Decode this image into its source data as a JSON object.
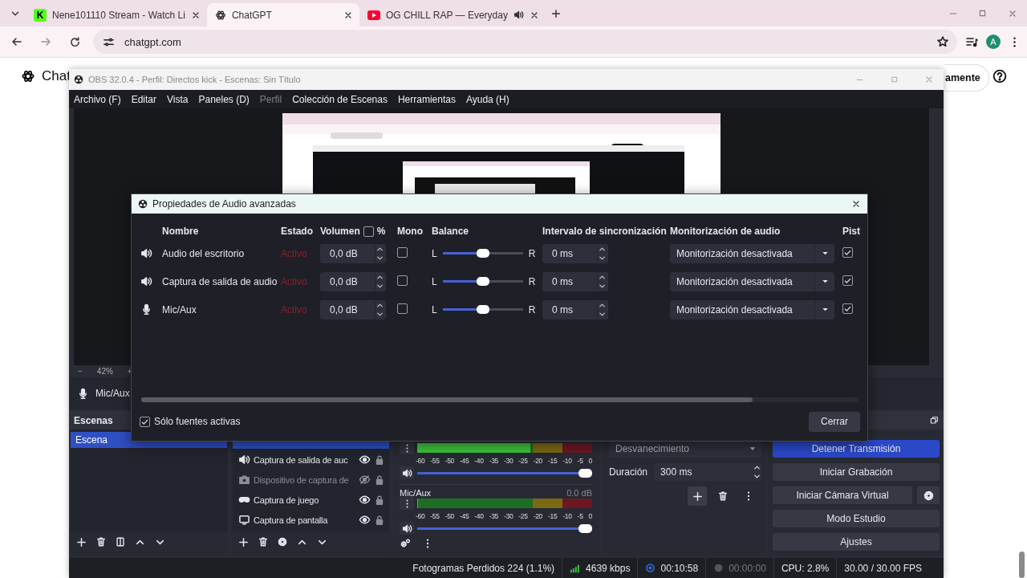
{
  "browser": {
    "tabs": [
      {
        "kind": "kick",
        "badge": "K",
        "title": "Nene101110 Stream - Watch Li",
        "selected": false,
        "audio": false
      },
      {
        "kind": "chatgpt",
        "title": "ChatGPT",
        "selected": true,
        "audio": false
      },
      {
        "kind": "youtube",
        "title": "OG CHILL RAP — Everyday",
        "selected": false,
        "audio": true
      }
    ],
    "address": "chatgpt.com",
    "avatar": "A"
  },
  "page": {
    "brand": "Chat",
    "button": "amente"
  },
  "obs": {
    "title": "OBS 32.0.4 - Perfil: Directos kick - Escenas: Sin Título",
    "menu": [
      {
        "label": "Archivo (F)",
        "disabled": false
      },
      {
        "label": "Editar",
        "disabled": false
      },
      {
        "label": "Vista",
        "disabled": false
      },
      {
        "label": "Paneles (D)",
        "disabled": false
      },
      {
        "label": "Perfil",
        "disabled": true
      },
      {
        "label": "Colección de Escenas",
        "disabled": false
      },
      {
        "label": "Herramientas",
        "disabled": false
      },
      {
        "label": "Ayuda (H)",
        "disabled": false
      }
    ],
    "zoom": {
      "minus": "−",
      "value": "42%",
      "plus": "+"
    },
    "strip": {
      "kind": "mic",
      "name": "Mic/Aux"
    },
    "scenes": {
      "title": "Escenas",
      "items": [
        {
          "name": "Escena",
          "selected": true
        }
      ]
    },
    "sources": [
      {
        "selected": true
      },
      {
        "kind": "speaker",
        "name": "Captura de salida de auc",
        "visible": true,
        "selected": false
      },
      {
        "kind": "camera",
        "name": "Dispositivo de captura de",
        "visible": false,
        "selected": false
      },
      {
        "kind": "gamepad",
        "name": "Captura de juego",
        "visible": true,
        "selected": false
      },
      {
        "kind": "monitor",
        "name": "Captura de pantalla",
        "visible": true,
        "selected": false
      }
    ],
    "mixer": [
      {
        "meter": {
          "level": 0.64
        },
        "volume": {
          "level": 1
        },
        "scale": [
          "-60",
          "-55",
          "-50",
          "-45",
          "-40",
          "-35",
          "-30",
          "-25",
          "-20",
          "-15",
          "-10",
          "-5",
          "0"
        ]
      },
      {
        "name": "Mic/Aux",
        "reading": "0.0 dB",
        "meter": {
          "level": 0
        },
        "volume": {
          "level": 1
        },
        "scale": [
          "-60",
          "-55",
          "-50",
          "-45",
          "-40",
          "-35",
          "-30",
          "-25",
          "-20",
          "-15",
          "-10",
          "-5",
          "0"
        ]
      }
    ],
    "transition": {
      "selected": "Desvanecimiento",
      "duration_label": "Duración",
      "duration": "300 ms"
    },
    "controls": [
      {
        "label": "Detener Transmisión",
        "active": true,
        "settings": false
      },
      {
        "label": "Iniciar Grabación",
        "active": false,
        "settings": false
      },
      {
        "label": "Iniciar Cámara Virtual",
        "active": false,
        "settings": true
      },
      {
        "label": "Modo Estudio",
        "active": false,
        "settings": false
      },
      {
        "label": "Ajustes",
        "active": false,
        "settings": false
      }
    ],
    "status": {
      "dropped": "Fotogramas Perdidos 224 (1.1%)",
      "bitrate": "4639 kbps",
      "streaming": true,
      "stream_time": "00:10:58",
      "recording": false,
      "record_time": "00:00:00",
      "cpu": "CPU: 2.8%",
      "fps": "30.00 / 30.00 FPS"
    }
  },
  "dialog": {
    "title": "Propiedades de Audio avanzadas",
    "header": {
      "name": "Nombre",
      "status": "Estado",
      "volume": "Volumen",
      "percent": "%",
      "percent_checked": false,
      "mono": "Mono",
      "balance": "Balance",
      "sync": "Intervalo de sincronización",
      "monitoring": "Monitorización de audio",
      "tracks": "Pist"
    },
    "rows": [
      {
        "kind": "speaker",
        "name": "Audio del escritorio",
        "status": "Activo",
        "volume": "0,0 dB",
        "mono": false,
        "left": "L",
        "balance": {
          "level": 0.5
        },
        "right": "R",
        "sync": "0 ms",
        "monitoring": "Monitorización desactivada",
        "track": true
      },
      {
        "kind": "speaker",
        "name": "Captura de salida de audio",
        "status": "Activo",
        "volume": "0,0 dB",
        "mono": false,
        "left": "L",
        "balance": {
          "level": 0.5
        },
        "right": "R",
        "sync": "0 ms",
        "monitoring": "Monitorización desactivada",
        "track": true
      },
      {
        "kind": "mic",
        "name": "Mic/Aux",
        "status": "Activo",
        "volume": "0,0 dB",
        "mono": false,
        "left": "L",
        "balance": {
          "level": 0.5
        },
        "right": "R",
        "sync": "0 ms",
        "monitoring": "Monitorización desactivada",
        "track": true
      }
    ],
    "only_active": {
      "label": "Sólo fuentes activas",
      "checked": true
    },
    "close": "Cerrar"
  }
}
